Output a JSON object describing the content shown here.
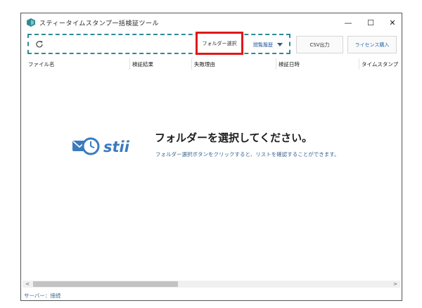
{
  "window": {
    "title": "スティータイムスタンプ一括検証ツール",
    "controls": {
      "minimize": "—",
      "maximize": "☐",
      "close": "✕"
    }
  },
  "toolbar": {
    "folder_button": "フォルダー選択",
    "history_button": "閲覧履歴",
    "csv_button": "CSV出力",
    "license_button": "ライセンス購入"
  },
  "table": {
    "columns": [
      "ファイル名",
      "検証結果",
      "失敗理由",
      "検証日時",
      "タイムスタンプ"
    ]
  },
  "empty_state": {
    "title": "フォルダーを選択してください。",
    "subtitle": "フォルダー選択ボタンをクリックすると、リストを確認することができます。",
    "logo_text": "stii"
  },
  "status_bar": {
    "text": "サーバー：接続"
  },
  "colors": {
    "accent": "#2f8a96",
    "highlight": "#e01818",
    "brand": "#3a7bbf"
  },
  "scrollbar": {
    "left_arrow": "<",
    "right_arrow": ">"
  }
}
